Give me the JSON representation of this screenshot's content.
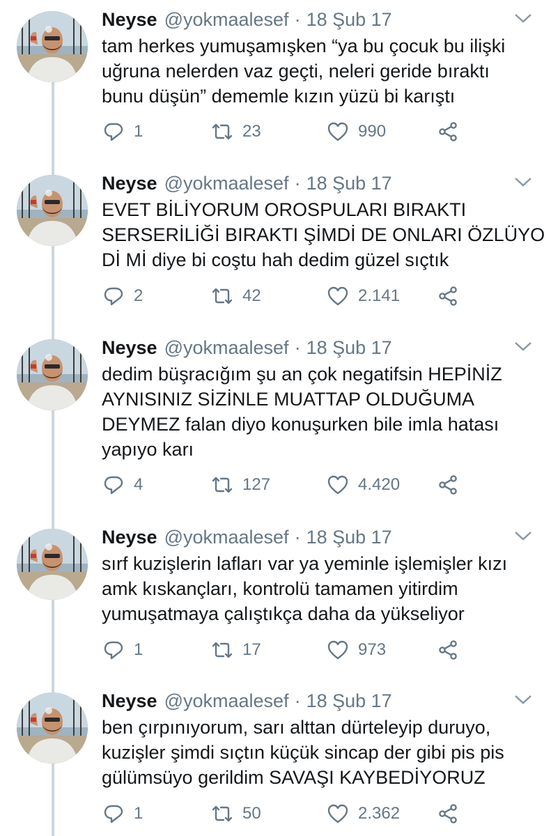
{
  "tweets": [
    {
      "name": "Neyse",
      "handle": "@yokmaalesef",
      "separator": "·",
      "date": "18 Şub 17",
      "lines": [
        "tam herkes yumuşamışken “ya bu çocuk bu ilişki",
        "uğruna nelerden vaz geçti, neleri geride bıraktı",
        "bunu düşün” dememle kızın yüzü bi karıştı"
      ],
      "replies": "1",
      "retweets": "23",
      "likes": "990"
    },
    {
      "name": "Neyse",
      "handle": "@yokmaalesef",
      "separator": "·",
      "date": "18 Şub 17",
      "lines": [
        "EVET BİLİYORUM OROSPULARI BIRAKTI",
        "SERSERİLİĞİ BIRAKTI ŞİMDİ DE ONLARI ÖZLÜYO",
        "Dİ Mİ diye bi coştu hah dedim güzel sıçtık"
      ],
      "replies": "2",
      "retweets": "42",
      "likes": "2.141"
    },
    {
      "name": "Neyse",
      "handle": "@yokmaalesef",
      "separator": "·",
      "date": "18 Şub 17",
      "lines": [
        "dedim büşracığım şu an çok negatifsin HEPİNİZ",
        "AYNISINIZ SİZİNLE MUATTAP OLDUĞUMA",
        "DEYMEZ falan diyo konuşurken bile imla hatası",
        "yapıyo karı"
      ],
      "replies": "4",
      "retweets": "127",
      "likes": "4.420"
    },
    {
      "name": "Neyse",
      "handle": "@yokmaalesef",
      "separator": "·",
      "date": "18 Şub 17",
      "lines": [
        "sırf kuzişlerin lafları var ya yeminle işlemişler kızı",
        "amk kıskançları, kontrolü tamamen yitirdim",
        "yumuşatmaya çalıştıkça daha da yükseliyor"
      ],
      "replies": "1",
      "retweets": "17",
      "likes": "973"
    },
    {
      "name": "Neyse",
      "handle": "@yokmaalesef",
      "separator": "·",
      "date": "18 Şub 17",
      "lines": [
        "ben çırpınıyorum, sarı alttan dürteleyip duruyo,",
        "kuzişler şimdi sıçtın küçük sincap der gibi pis pis",
        "gülümsüyo gerildim SAVAŞI KAYBEDİYORUZ"
      ],
      "replies": "1",
      "retweets": "50",
      "likes": "2.362"
    }
  ],
  "icons": {
    "reply": "reply-icon",
    "retweet": "retweet-icon",
    "like": "heart-icon",
    "share": "share-icon",
    "caret": "chevron-down-icon"
  },
  "colors": {
    "text": "#14171a",
    "secondary": "#657786",
    "thread_line": "#ccd6dd"
  }
}
